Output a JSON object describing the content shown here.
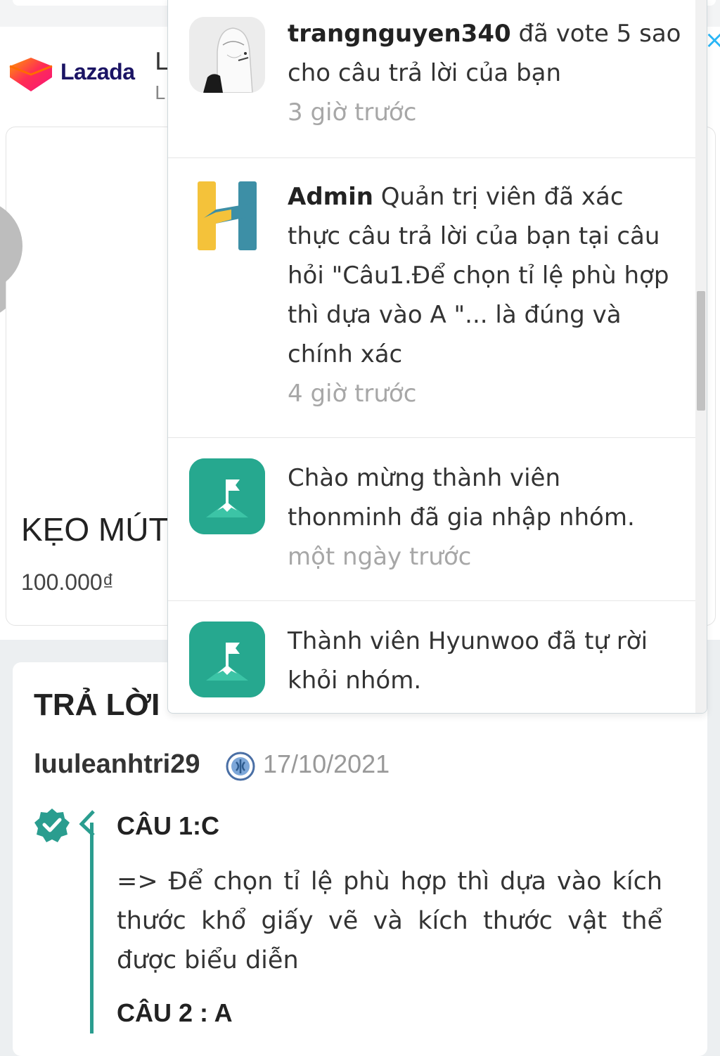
{
  "ad": {
    "brand": "Lazada",
    "title_partial": "L",
    "subtitle_partial": "L",
    "product_name": "KẸO MÚT",
    "product_price": "100.000₫",
    "close_icon": "×"
  },
  "notifications": [
    {
      "user": "trangnguyen340",
      "message": " đã vote 5 sao cho câu trả lời của bạn",
      "time": "3 giờ trước",
      "avatar": "user-photo"
    },
    {
      "user": "Admin",
      "message": " Quản trị viên đã xác thực câu trả lời của bạn tại câu hỏi \"Câu1.Để chọn tỉ lệ phù hợp thì dựa vào A \"... là đúng và chính xác",
      "time": "4 giờ trước",
      "avatar": "hoc24-logo"
    },
    {
      "user": "",
      "message": " Chào mừng thành viên thonminh đã gia nhập nhóm.",
      "time": "một ngày trước",
      "avatar": "group-flag-icon"
    },
    {
      "user": "",
      "message": " Thành viên Hyunwoo đã tự rời khỏi nhóm.",
      "time": "",
      "avatar": "group-flag-icon"
    }
  ],
  "answer": {
    "heading": "TRẢ LỜI",
    "username": "luuleanhtri29",
    "date": "17/10/2021",
    "q1": "CÂU 1:C",
    "body": "=> Để chọn tỉ lệ phù hợp thì dựa vào kích thước khổ giấy vẽ và kích thước vật thể được biểu diễn",
    "q2": "CÂU 2 : A"
  },
  "colors": {
    "accent_teal": "#2a9d8f",
    "group_icon": "#26a88f",
    "lazada_navy": "#1b1464",
    "close_blue": "#29b6f6"
  }
}
